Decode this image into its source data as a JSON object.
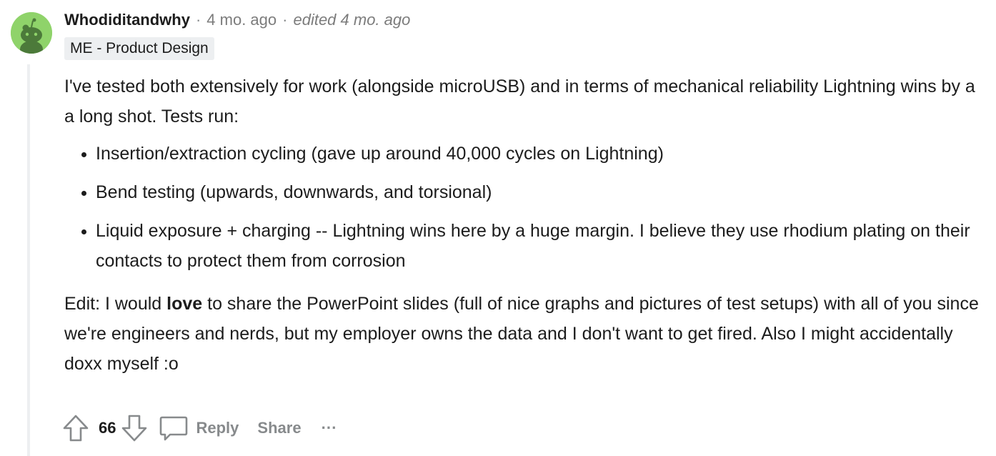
{
  "comment": {
    "author": "Whodiditandwhy",
    "separator": "·",
    "timestamp": "4 mo. ago",
    "edited": "edited 4 mo. ago",
    "flair": "ME - Product Design",
    "intro": "I've tested both extensively for work (alongside microUSB) and in terms of mechanical reliability Lightning wins by a a long shot. Tests run:",
    "tests": [
      "Insertion/extraction cycling (gave up around 40,000 cycles on Lightning)",
      "Bend testing (upwards, downwards, and torsional)",
      "Liquid exposure + charging -- Lightning wins here by a huge margin. I believe they use rhodium plating on their contacts to protect them from corrosion"
    ],
    "edit_prefix": "Edit: I would ",
    "edit_emphasis": "love",
    "edit_suffix": " to share the PowerPoint slides (full of nice graphs and pictures of test setups) with all of you since we're engineers and nerds, but my employer owns the data and I don't want to get fired. Also I might accidentally doxx myself :o"
  },
  "actions": {
    "score": "66",
    "reply_label": "Reply",
    "share_label": "Share",
    "more_label": "···"
  },
  "icons": {
    "upvote": "upvote-arrow-icon",
    "downvote": "downvote-arrow-icon",
    "reply": "speech-bubble-icon",
    "avatar": "snoo-avatar-icon"
  },
  "colors": {
    "avatar_bg": "#8fd36a",
    "muted": "#878a8c",
    "flair_bg": "#edeff1"
  }
}
